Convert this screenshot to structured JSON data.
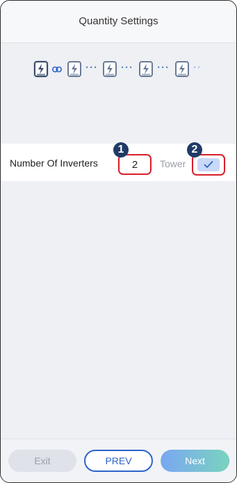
{
  "header": {
    "title": "Quantity Settings"
  },
  "diagram": {
    "inverter_icon": "lightning-bolt-icon",
    "link_icon": "link-chain-icon",
    "dots": "···",
    "fade_dots": "··"
  },
  "settings": {
    "inverters_label": "Number Of Inverters",
    "inverters_value": "2",
    "tower_label": "Tower",
    "tower_checked": true
  },
  "markers": {
    "first": "1",
    "second": "2"
  },
  "footer": {
    "exit_label": "Exit",
    "prev_label": "PREV",
    "next_label": "Next"
  },
  "colors": {
    "accent": "#2d63c8",
    "highlight_border": "#d81e2a",
    "marker_bg": "#1f3a66",
    "next_gradient_start": "#7aa7f2",
    "next_gradient_end": "#79d3bf"
  }
}
